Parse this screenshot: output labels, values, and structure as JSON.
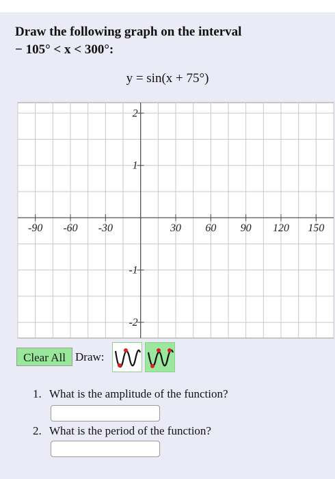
{
  "problem": {
    "instruction": "Draw the following graph on the interval",
    "interval": "− 105° < x < 300°:",
    "equation": "y = sin(x + 75°)"
  },
  "graph": {
    "x_min": -105,
    "x_max": 165,
    "y_min": -2.3,
    "y_max": 2.2,
    "x_labels": [
      "-90",
      "-60",
      "-30",
      "30",
      "60",
      "90",
      "120",
      "150"
    ],
    "x_label_values": [
      -90,
      -60,
      -30,
      30,
      60,
      90,
      120,
      150
    ],
    "y_labels": [
      "2",
      "1",
      "-1",
      "-2"
    ],
    "y_label_values": [
      2,
      1,
      -1,
      -2
    ],
    "grid_color": "#c8c8c8",
    "axis_color": "#4a4a4a"
  },
  "toolbar": {
    "clear_label": "Clear All",
    "draw_label": "Draw:",
    "tools": [
      "sine-wave-tool-icon",
      "sine-wave-peaks-tool-icon"
    ],
    "button_color": "#98e79a"
  },
  "questions": [
    {
      "number": "1.",
      "text": "What is the amplitude of the function?",
      "answer": ""
    },
    {
      "number": "2.",
      "text": "What is the period of the function?",
      "answer": ""
    }
  ]
}
